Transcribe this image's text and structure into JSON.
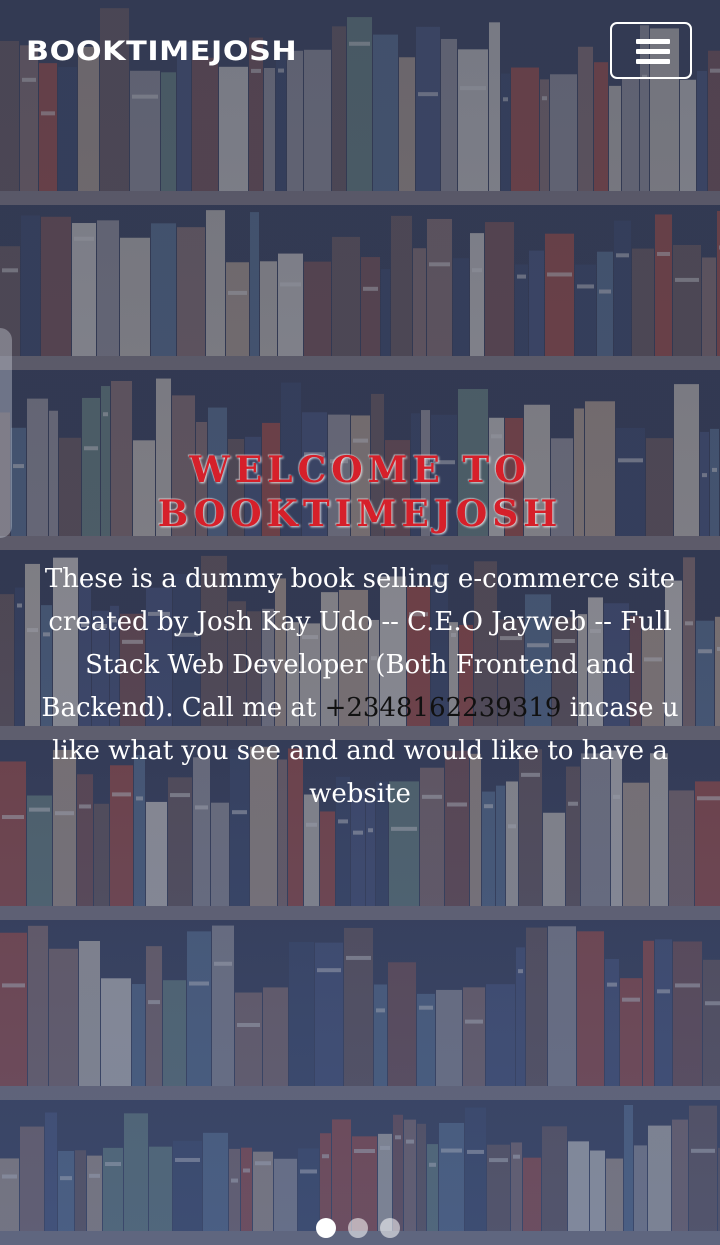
{
  "navbar": {
    "brand": "BOOKTIMEJOSH",
    "menu_icon": "hamburger-menu-icon"
  },
  "hero": {
    "title_line1": "WELCOME TO",
    "title_line2": "BOOKTIMEJOSH",
    "desc_before_phone": "These is a dummy book selling e-commerce site created by Josh Kay Udo -- C.E.O Jayweb -- Full Stack Web Developer (Both Frontend and Backend). Call me at ",
    "phone": "+2348162239319",
    "desc_after_phone": " incase u like what you see and and would like to have a website"
  },
  "carousel": {
    "slide_count": 3,
    "active_index": 0
  },
  "colors": {
    "title_red": "#d6202a",
    "overlay_blue": "#2c3a5f",
    "text_white": "#ffffff",
    "phone_text": "#111111"
  }
}
